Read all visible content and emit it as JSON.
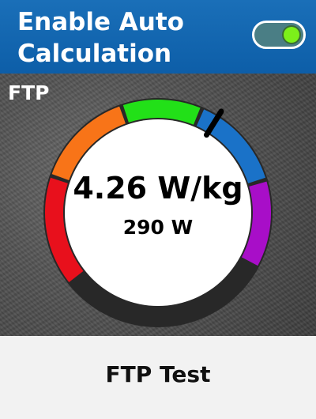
{
  "header": {
    "title": "Enable Auto\nCalculation",
    "toggle_state": "on",
    "toggle_knob_color": "#7cf01a"
  },
  "gauge": {
    "label": "FTP",
    "value_wkg": "4.26 W/kg",
    "value_watts": "290 W",
    "zones": [
      {
        "name": "zone-1",
        "color": "#e8101c"
      },
      {
        "name": "zone-2",
        "color": "#f87418"
      },
      {
        "name": "zone-3",
        "color": "#22e018"
      },
      {
        "name": "zone-4",
        "color": "#1a72c8"
      },
      {
        "name": "zone-5",
        "color": "#a80ec8"
      }
    ],
    "indicator_color": "#000000"
  },
  "footer": {
    "button_label": "FTP Test"
  }
}
